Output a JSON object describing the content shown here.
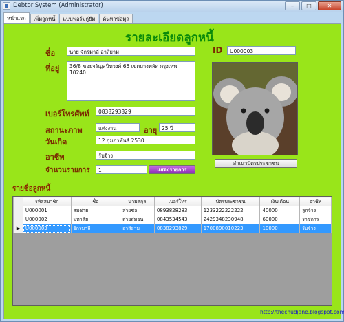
{
  "window": {
    "title": "Debtor System (Administrator)",
    "minimize": "–",
    "maximize": "□",
    "close": "✕"
  },
  "tabs": [
    {
      "label": "หน้าแรก",
      "active": true
    },
    {
      "label": "เพิ่มลูกหนี้",
      "active": false
    },
    {
      "label": "แบบฟอร์มกู้ยืม",
      "active": false
    },
    {
      "label": "ค้นหาข้อมูล",
      "active": false
    }
  ],
  "page": {
    "heading": "รายละเอียดลูกหนี้",
    "name_label": "ชื่อ",
    "name_value": "นาย จักรมาลี อาสิยาม",
    "id_label": "ID",
    "id_value": "U000003",
    "address_label": "ที่อยู่",
    "address_value": "36/8 ซอยจรัญสนิทวงศ์ 65 เขตบางพลัด กรุงเทพ 10240",
    "phone_label": "เบอร์โทรศัพท์",
    "phone_value": "0838293829",
    "status_label": "สถานะภาพ",
    "status_value": "แต่งงาน",
    "age_label": "อายุ",
    "age_value": "25 ปี",
    "birth_label": "วันเกิด",
    "birth_value": "12 กุมภาพันธ์ 2530",
    "job_label": "อาชีพ",
    "job_value": "รับจ้าง",
    "count_label": "จำนวนรายการ",
    "count_value": "1",
    "show_items_button": "แสดงรายการ",
    "idcard_copy_button": "สำเนาบัตรประชาชน",
    "list_title": "รายชื่อลูกหนี้",
    "footer_link": "http://thechudjane.blogspot.com"
  },
  "table": {
    "columns": [
      "รหัสสมาชิก",
      "ชื่อ",
      "นามสกุล",
      "เบอร์โทร",
      "บัตรประชาชน",
      "เงินเดือน",
      "อาชีพ"
    ],
    "rows": [
      [
        "U000001",
        "สมชาย",
        "สายชล",
        "0893828283",
        "1233222222222",
        "40000",
        "ลูกจ้าง"
      ],
      [
        "U000002",
        "มหาสัย",
        "สายสมอน",
        "0843534543",
        "2429348230948",
        "60000",
        "ราชการ"
      ],
      [
        "U000003",
        "จักรมาลี",
        "อาสิยาม",
        "0838293829",
        "1700890010223",
        "10000",
        "รับจ้าง"
      ]
    ],
    "selected_row": 2,
    "row_pointer": "▶"
  },
  "colors": {
    "panel": "#99e51a",
    "heading": "#0b8a0b",
    "label": "#7a2a00",
    "selection": "#3399ff"
  }
}
